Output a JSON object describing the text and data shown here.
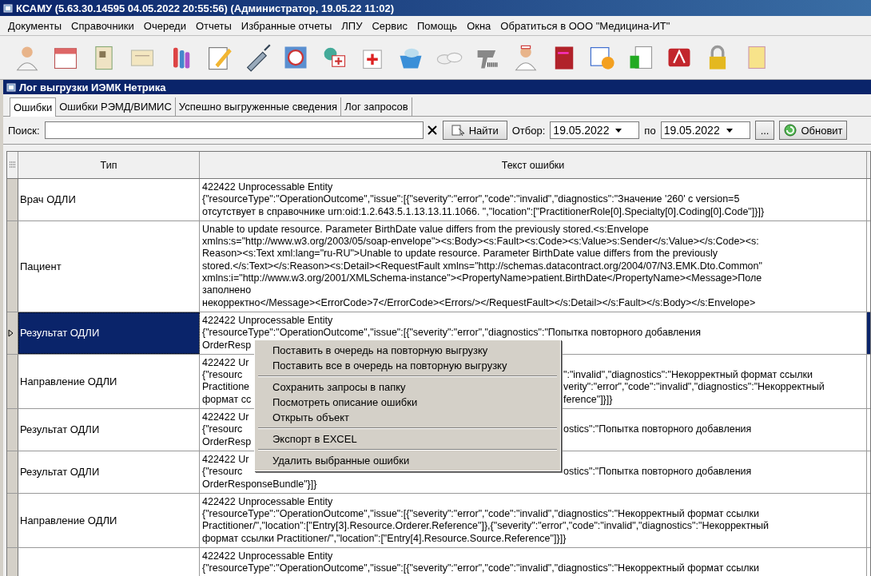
{
  "window": {
    "title": "КСАМУ (5.63.30.14595 04.05.2022 20:55:56) (Администратор, 19.05.22 11:02)"
  },
  "menu_bar": [
    "Документы",
    "Справочники",
    "Очереди",
    "Отчеты",
    "Избранные отчеты",
    "ЛПУ",
    "Сервис",
    "Помощь",
    "Окна",
    "Обратиться в ООО \"Медицина-ИТ\""
  ],
  "child_window": {
    "title": "Лог выгрузки ИЭМК Нетрика"
  },
  "tabs": [
    {
      "label": "Ошибки",
      "selected": true
    },
    {
      "label": "Ошибки РЭМД/ВИМИС",
      "selected": false
    },
    {
      "label": "Успешно выгруженные сведения",
      "selected": false
    },
    {
      "label": "Лог запросов",
      "selected": false
    }
  ],
  "filter_bar": {
    "search_label": "Поиск:",
    "find_button": "Найти",
    "filter_label": "Отбор:",
    "date_from": "19.05.2022",
    "range_label": "по",
    "date_to": "19.05.2022",
    "more_button": "...",
    "refresh_button": "Обновит"
  },
  "table": {
    "columns": [
      "Тип",
      "Текст ошибки"
    ],
    "rows": [
      {
        "type": "Врач ОДЛИ",
        "selected": false,
        "lines": [
          {
            "kind": "full",
            "text": "422422 Unprocessable Entity"
          },
          {
            "kind": "full",
            "text": " {\"resourceType\":\"OperationOutcome\",\"issue\":[{\"severity\":\"error\",\"code\":\"invalid\",\"diagnostics\":\"Значение '260' c version=5"
          },
          {
            "kind": "full",
            "text": "отсутствует в справочнике urn:oid:1.2.643.5.1.13.13.11.1066. \",\"location\":[\"PractitionerRole[0].Specialty[0].Coding[0].Code\"]}]}"
          }
        ]
      },
      {
        "type": "Пациент",
        "selected": false,
        "lines": [
          {
            "kind": "full",
            "text": "Unable to update resource. Parameter BirthDate value differs from the previously stored.<s:Envelope"
          },
          {
            "kind": "full",
            "text": "xmlns:s=\"http://www.w3.org/2003/05/soap-envelope\"><s:Body><s:Fault><s:Code><s:Value>s:Sender</s:Value></s:Code><s:"
          },
          {
            "kind": "full",
            "text": "Reason><s:Text xml:lang=\"ru-RU\">Unable to update resource. Parameter BirthDate value differs from the previously"
          },
          {
            "kind": "full",
            "text": "stored.</s:Text></s:Reason><s:Detail><RequestFault xmlns=\"http://schemas.datacontract.org/2004/07/N3.EMK.Dto.Common\""
          },
          {
            "kind": "full",
            "text": "xmlns:i=\"http://www.w3.org/2001/XMLSchema-instance\"><PropertyName>patient.BirthDate</PropertyName><Message>Поле"
          },
          {
            "kind": "full",
            "text": "заполнено"
          },
          {
            "kind": "full",
            "text": "некорректно</Message><ErrorCode>7</ErrorCode><Errors/></RequestFault></s:Detail></s:Fault></s:Body></s:Envelope>"
          }
        ]
      },
      {
        "type": "Результат ОДЛИ",
        "selected": true,
        "lines": [
          {
            "kind": "full",
            "text": "422422 Unprocessable Entity"
          },
          {
            "kind": "full",
            "text": " {\"resourceType\":\"OperationOutcome\",\"issue\":[{\"severity\":\"error\",\"diagnostics\":\"Попытка повторного добавления"
          },
          {
            "kind": "split",
            "left": "OrderResp"
          }
        ]
      },
      {
        "type": "Направление ОДЛИ",
        "selected": false,
        "lines": [
          {
            "kind": "split",
            "left": "422422 Ur"
          },
          {
            "kind": "split",
            "left": " {\"resourc",
            "right": "\":\"invalid\",\"diagnostics\":\"Некорректный формат ссылки"
          },
          {
            "kind": "split",
            "left": "Practitione",
            "right": "verity\":\"error\",\"code\":\"invalid\",\"diagnostics\":\"Некорректный"
          },
          {
            "kind": "split",
            "left": "формат сс",
            "right": "ference\"]}]}"
          }
        ]
      },
      {
        "type": "Результат ОДЛИ",
        "selected": false,
        "lines": [
          {
            "kind": "split",
            "left": "422422 Ur"
          },
          {
            "kind": "split",
            "left": " {\"resourc",
            "right": "ostics\":\"Попытка повторного добавления"
          },
          {
            "kind": "split",
            "left": "OrderResp"
          }
        ]
      },
      {
        "type": "Результат ОДЛИ",
        "selected": false,
        "lines": [
          {
            "kind": "split",
            "left": "422422 Ur"
          },
          {
            "kind": "split",
            "left": " {\"resourc",
            "right": "ostics\":\"Попытка повторного добавления"
          },
          {
            "kind": "full",
            "text": "OrderResponseBundle\"}]}"
          }
        ]
      },
      {
        "type": "Направление ОДЛИ",
        "selected": false,
        "lines": [
          {
            "kind": "full",
            "text": "422422 Unprocessable Entity"
          },
          {
            "kind": "full",
            "text": " {\"resourceType\":\"OperationOutcome\",\"issue\":[{\"severity\":\"error\",\"code\":\"invalid\",\"diagnostics\":\"Некорректный формат ссылки"
          },
          {
            "kind": "full",
            "text": "Practitioner/\",\"location\":[\"Entry[3].Resource.Orderer.Reference\"]},{\"severity\":\"error\",\"code\":\"invalid\",\"diagnostics\":\"Некорректный"
          },
          {
            "kind": "full",
            "text": "формат ссылки Practitioner/\",\"location\":[\"Entry[4].Resource.Source.Reference\"]}]}"
          }
        ]
      },
      {
        "selected": false,
        "lines": [
          {
            "kind": "full",
            "text": "422422 Unprocessable Entity"
          },
          {
            "kind": "full",
            "text": " {\"resourceType\":\"OperationOutcome\",\"issue\":[{\"severity\":\"error\",\"code\":\"invalid\",\"diagnostics\":\"Некорректный формат ссылки"
          }
        ]
      }
    ]
  },
  "context_menu": {
    "items": [
      {
        "kind": "item",
        "label": "Поставить в очередь на повторную выгрузку"
      },
      {
        "kind": "item",
        "label": "Поставить все в очередь на повторную выгрузку"
      },
      {
        "kind": "separator"
      },
      {
        "kind": "item",
        "label": "Сохранить запросы в папку"
      },
      {
        "kind": "item",
        "label": "Посмотреть описание ошибки"
      },
      {
        "kind": "item",
        "label": "Открыть объект"
      },
      {
        "kind": "separator"
      },
      {
        "kind": "item",
        "label": "Экспорт в EXCEL"
      },
      {
        "kind": "separator"
      },
      {
        "kind": "item",
        "label": "Удалить выбранные ошибки"
      }
    ]
  }
}
